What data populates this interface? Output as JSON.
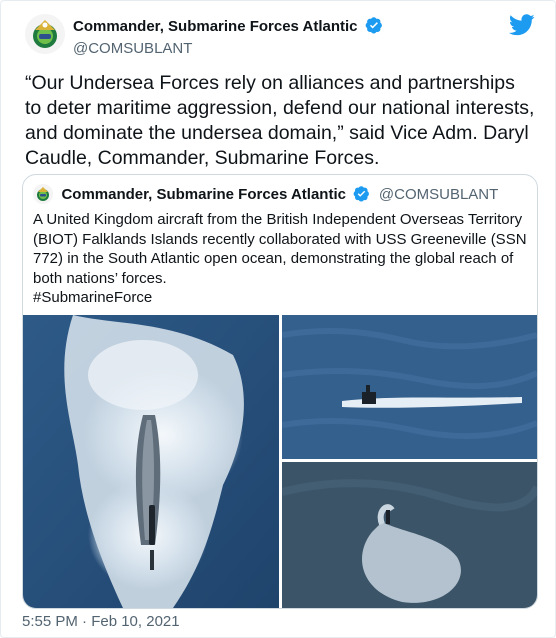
{
  "tweet": {
    "author_name": "Commander, Submarine Forces Atlantic",
    "author_handle": "@COMSUBLANT",
    "text": "“Our Undersea Forces rely on alliances and partnerships to deter maritime aggression, defend our national interests, and dominate the undersea domain,” said Vice Adm. Daryl Caudle, Commander, Submarine Forces.",
    "timestamp": "5:55 PM · Feb 10, 2021"
  },
  "quoted_tweet": {
    "author_name": "Commander, Submarine Forces Atlantic",
    "author_handle": "@COMSUBLANT",
    "text": "A United Kingdom aircraft from the British Independent Overseas Territory (BIOT) Falklands Islands recently collaborated with USS Greeneville (SSN 772) in the South Atlantic open ocean, demonstrating the global reach of both nations’ forces.",
    "hashtag": "#SubmarineForce"
  },
  "icons": {
    "verified": "verified-badge-icon",
    "platform": "twitter-bird-icon"
  },
  "colors": {
    "brand_blue": "#1d9bf0",
    "ocean": "#2b4f78",
    "foam": "#e8eef4"
  }
}
